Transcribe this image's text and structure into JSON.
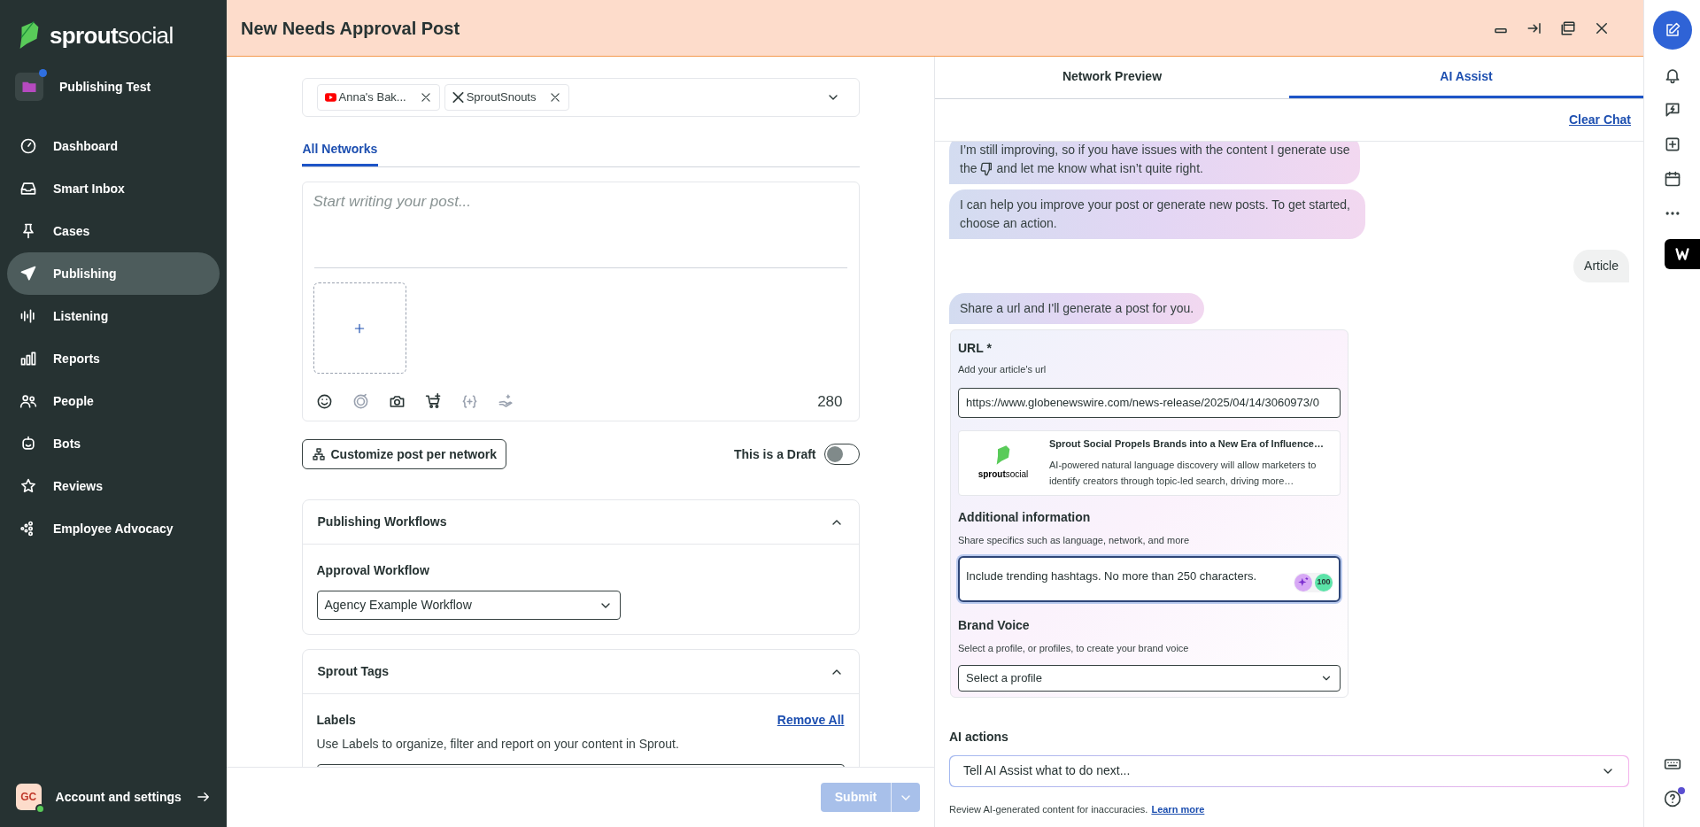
{
  "sidebar": {
    "logo": {
      "first": "sprout",
      "second": "social"
    },
    "workspace": {
      "name": "Publishing Test",
      "notification": true
    },
    "nav": [
      {
        "label": "Dashboard",
        "selected": false
      },
      {
        "label": "Smart Inbox",
        "selected": false
      },
      {
        "label": "Cases",
        "selected": false
      },
      {
        "label": "Publishing",
        "selected": true
      },
      {
        "label": "Listening",
        "selected": false
      },
      {
        "label": "Reports",
        "selected": false
      },
      {
        "label": "People",
        "selected": false
      },
      {
        "label": "Bots",
        "selected": false
      },
      {
        "label": "Reviews",
        "selected": false
      },
      {
        "label": "Employee Advocacy",
        "selected": false
      }
    ],
    "account": {
      "initials": "GC",
      "label": "Account and settings",
      "online": true
    }
  },
  "header": {
    "title": "New Needs Approval Post"
  },
  "composer": {
    "profiles": [
      {
        "kind": "youtube",
        "name": "Anna's Bak..."
      },
      {
        "kind": "x",
        "name": "SproutSnouts"
      }
    ],
    "tabs": [
      {
        "label": "All Networks",
        "selected": true
      }
    ],
    "placeholder": "Start writing your post...",
    "char_count": "280",
    "customize_button": "Customize post per network",
    "draft": {
      "label": "This is a Draft",
      "on": false
    },
    "sections": [
      {
        "kind": "select",
        "title": "Publishing Workflows",
        "expanded": true,
        "field_label": "Approval Workflow",
        "value": "Agency Example Workflow"
      },
      {
        "kind": "labels",
        "title": "Sprout Tags",
        "expanded": true,
        "field_label": "Labels",
        "action": "Remove All",
        "description": "Use Labels to organize, filter and report on your content in Sprout."
      }
    ],
    "submit": {
      "label": "Submit",
      "disabled": true
    }
  },
  "assist": {
    "tabs": [
      {
        "label": "Network Preview",
        "selected": false
      },
      {
        "label": "AI Assist",
        "selected": true
      }
    ],
    "clear_chat": "Clear Chat",
    "messages": [
      {
        "kind": "assistant",
        "lines": [
          [
            "I’m still improving, so if you have issues with the content I generate use"
          ],
          [
            "the",
            "and let me know what isn’t quite right."
          ]
        ]
      },
      {
        "kind": "assistant",
        "lines": [
          [
            "I can help you improve your post or generate new posts. To get started, choose an action."
          ]
        ]
      },
      {
        "kind": "user",
        "lines": [
          [
            "Article"
          ]
        ]
      },
      {
        "kind": "assistant",
        "lines": [
          [
            "Share a url and I'll generate a post for you."
          ]
        ]
      }
    ],
    "form": {
      "url_label": "URL *",
      "url_hint": "Add your article's url",
      "url_value": "https://www.globenewswire.com/news-release/2025/04/14/3060973/0",
      "preview": {
        "logo_first": "sprout",
        "logo_second": "social",
        "title": "Sprout Social Propels Brands into a New Era of Influence…",
        "description": "AI-powered natural language discovery will allow marketers to identify creators through topic-led search, driving more…"
      },
      "additional_label": "Additional information",
      "additional_hint": "Share specifics such as language, network, and more",
      "additional_value": "Include trending hashtags. No more than 250 characters.",
      "score": "100",
      "voice_label": "Brand Voice",
      "voice_hint": "Select a profile, or profiles, to create your brand voice",
      "voice_placeholder": "Select a profile"
    },
    "actions_label": "AI actions",
    "actions_placeholder": "Tell AI Assist what to do next...",
    "disclaimer": "Review AI-generated content for inaccuracies.",
    "learn_more": "Learn more"
  },
  "rail": {
    "help_notification": true
  }
}
